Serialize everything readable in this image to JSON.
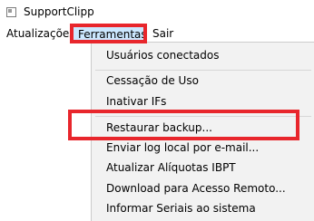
{
  "window": {
    "title": "SupportClipp",
    "icon": "app-icon"
  },
  "menubar": {
    "items": [
      {
        "label": "Atualizações"
      },
      {
        "label": "Ferramentas"
      },
      {
        "label": "Sair"
      }
    ]
  },
  "dropdown": {
    "items": [
      {
        "label": "Usuários conectados"
      },
      {
        "label": "Cessação de Uso"
      },
      {
        "label": "Inativar IFs"
      },
      {
        "label": "Restaurar backup..."
      },
      {
        "label": "Enviar log local por e-mail..."
      },
      {
        "label": "Atualizar Alíquotas IBPT"
      },
      {
        "label": "Download para Acesso Remoto..."
      },
      {
        "label": "Informar Seriais ao sistema"
      }
    ]
  },
  "highlight": {
    "color": "#e8262c",
    "targets": [
      "Ferramentas",
      "Restaurar backup..."
    ]
  },
  "colors": {
    "menu_active_bg": "#cce8ff",
    "menu_active_border": "#99d1ff",
    "dropdown_bg": "#f2f2f2"
  }
}
